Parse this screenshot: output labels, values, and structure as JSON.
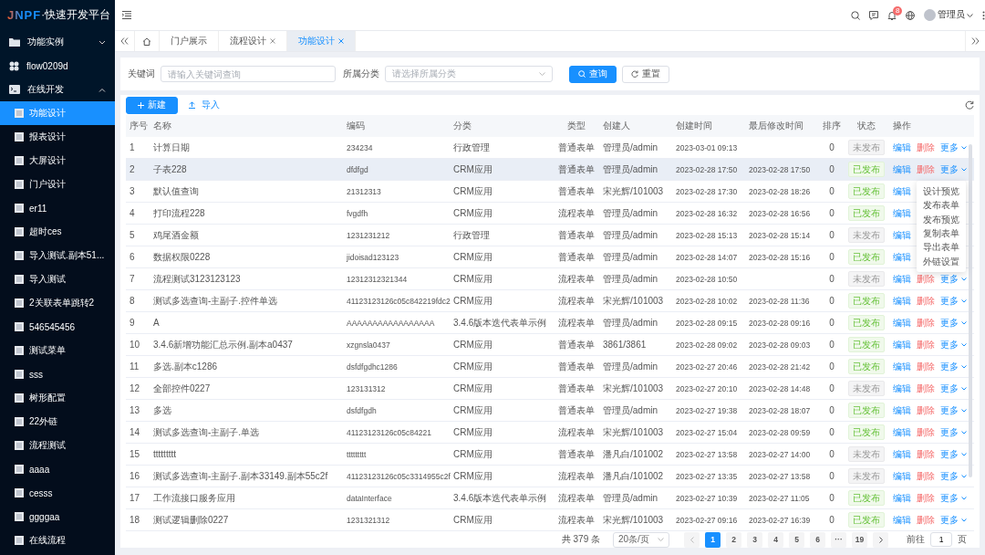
{
  "sidebar": {
    "logo": {
      "mark": "JNPF",
      "text": "·快速开发平台"
    },
    "items": [
      {
        "label": "功能实例",
        "expanded": false,
        "selected": false
      },
      {
        "label": "flow0209d",
        "selected": false
      },
      {
        "label": "在线开发",
        "expanded": true,
        "selected": false,
        "children": [
          {
            "label": "功能设计",
            "selected": true
          },
          {
            "label": "报表设计",
            "selected": false
          },
          {
            "label": "大屏设计",
            "selected": false
          },
          {
            "label": "门户设计",
            "selected": false
          },
          {
            "label": "er11",
            "selected": false
          },
          {
            "label": "超时ces",
            "selected": false
          },
          {
            "label": "导入测试.副本51...",
            "selected": false
          },
          {
            "label": "导入测试",
            "selected": false
          },
          {
            "label": "2关联表单跳转2",
            "selected": false
          },
          {
            "label": "546545456",
            "selected": false
          },
          {
            "label": "测试菜单",
            "selected": false
          },
          {
            "label": "sss",
            "selected": false
          },
          {
            "label": "树形配置",
            "selected": false
          },
          {
            "label": "22外链",
            "selected": false
          },
          {
            "label": "流程测试",
            "selected": false
          },
          {
            "label": "aaaa",
            "selected": false
          },
          {
            "label": "cesss",
            "selected": false
          },
          {
            "label": "ggggaa",
            "selected": false
          },
          {
            "label": "在线流程",
            "selected": false
          }
        ]
      }
    ]
  },
  "header": {
    "notification_count": "8",
    "user": "管理员"
  },
  "tabs": [
    {
      "label": "门户展示",
      "closable": false,
      "selected": false
    },
    {
      "label": "流程设计",
      "closable": true,
      "selected": false
    },
    {
      "label": "功能设计",
      "closable": true,
      "selected": true
    }
  ],
  "search": {
    "keyword_label": "关键词",
    "keyword_placeholder": "请输入关键词查询",
    "category_label": "所属分类",
    "category_placeholder": "请选择所属分类",
    "search_button": "查询",
    "reset_button": "重置"
  },
  "toolbar": {
    "new_button": "新建",
    "import_button": "导入"
  },
  "table": {
    "columns": [
      "序号",
      "名称",
      "编码",
      "分类",
      "类型",
      "创建人",
      "创建时间",
      "最后修改时间",
      "排序",
      "状态",
      "操作"
    ],
    "rows": [
      {
        "cells": [
          "1",
          "计算日期",
          "234234",
          "行政管理",
          "普通表单",
          "管理员/admin",
          "2023-03-01 09:13",
          "",
          "0"
        ],
        "status": "未发布",
        "published": false,
        "hovered": false,
        "actions": [
          {
            "kind": "edit",
            "label": "编辑"
          },
          {
            "kind": "delete",
            "label": "删除"
          },
          {
            "kind": "more",
            "label": "更多"
          }
        ]
      },
      {
        "cells": [
          "2",
          "子表228",
          "dfdfgd",
          "CRM应用",
          "普通表单",
          "管理员/admin",
          "2023-02-28 17:50",
          "2023-02-28 17:50",
          "0"
        ],
        "status": "已发布",
        "published": true,
        "hovered": true,
        "actions": [
          {
            "kind": "edit",
            "label": "编辑"
          },
          {
            "kind": "delete",
            "label": "删除"
          },
          {
            "kind": "more",
            "label": "更多"
          }
        ]
      },
      {
        "cells": [
          "3",
          "默认值查询",
          "21312313",
          "CRM应用",
          "普通表单",
          "宋光辉/101003",
          "2023-02-28 17:30",
          "2023-02-28 18:26",
          "0"
        ],
        "status": "已发布",
        "published": true,
        "hovered": false,
        "actions": [
          {
            "kind": "edit",
            "label": "编辑"
          }
        ]
      },
      {
        "cells": [
          "4",
          "打印流程228",
          "fvgdfh",
          "CRM应用",
          "流程表单",
          "管理员/admin",
          "2023-02-28 16:32",
          "2023-02-28 16:56",
          "0"
        ],
        "status": "已发布",
        "published": true,
        "hovered": false,
        "actions": [
          {
            "kind": "edit",
            "label": "编辑"
          }
        ]
      },
      {
        "cells": [
          "5",
          "鸡尾酒金额",
          "1231231212",
          "行政管理",
          "普通表单",
          "管理员/admin",
          "2023-02-28 15:13",
          "2023-02-28 15:14",
          "0"
        ],
        "status": "未发布",
        "published": false,
        "hovered": false,
        "actions": [
          {
            "kind": "edit",
            "label": "编辑"
          }
        ]
      },
      {
        "cells": [
          "6",
          "数据权限0228",
          "jidoisad123123",
          "CRM应用",
          "普通表单",
          "管理员/admin",
          "2023-02-28 14:07",
          "2023-02-28 15:16",
          "0"
        ],
        "status": "已发布",
        "published": true,
        "hovered": false,
        "actions": [
          {
            "kind": "edit",
            "label": "编辑"
          }
        ]
      },
      {
        "cells": [
          "7",
          "流程测试3123123123",
          "12312312321344",
          "CRM应用",
          "流程表单",
          "管理员/admin",
          "2023-02-28 10:50",
          "",
          "0"
        ],
        "status": "未发布",
        "published": false,
        "hovered": false,
        "actions": [
          {
            "kind": "edit",
            "label": "编辑"
          },
          {
            "kind": "delete",
            "label": "删除"
          },
          {
            "kind": "more",
            "label": "更多"
          }
        ]
      },
      {
        "cells": [
          "8",
          "测试多选查询-主副子.控件单选",
          "41123123126c05c842219fdc2",
          "CRM应用",
          "流程表单",
          "宋光辉/101003",
          "2023-02-28 10:02",
          "2023-02-28 11:36",
          "0"
        ],
        "status": "已发布",
        "published": true,
        "hovered": false,
        "actions": [
          {
            "kind": "edit",
            "label": "编辑"
          },
          {
            "kind": "delete",
            "label": "删除"
          },
          {
            "kind": "more",
            "label": "更多"
          }
        ]
      },
      {
        "cells": [
          "9",
          "A",
          "AAAAAAAAAAAAAAAAA",
          "3.4.6版本迭代表单示例",
          "流程表单",
          "管理员/admin",
          "2023-02-28 09:15",
          "2023-02-28 09:16",
          "0"
        ],
        "status": "已发布",
        "published": true,
        "hovered": false,
        "actions": [
          {
            "kind": "edit",
            "label": "编辑"
          },
          {
            "kind": "delete",
            "label": "删除"
          },
          {
            "kind": "more",
            "label": "更多"
          }
        ]
      },
      {
        "cells": [
          "10",
          "3.4.6新增功能汇总示例.副本a0437",
          "xzgnsla0437",
          "CRM应用",
          "普通表单",
          "3861/3861",
          "2023-02-28 09:02",
          "2023-02-28 09:03",
          "0"
        ],
        "status": "已发布",
        "published": true,
        "hovered": false,
        "actions": [
          {
            "kind": "edit",
            "label": "编辑"
          },
          {
            "kind": "delete",
            "label": "删除"
          },
          {
            "kind": "more",
            "label": "更多"
          }
        ]
      },
      {
        "cells": [
          "11",
          "多选.副本c1286",
          "dsfdfgdhc1286",
          "CRM应用",
          "普通表单",
          "管理员/admin",
          "2023-02-27 20:46",
          "2023-02-28 21:42",
          "0"
        ],
        "status": "已发布",
        "published": true,
        "hovered": false,
        "actions": [
          {
            "kind": "edit",
            "label": "编辑"
          },
          {
            "kind": "delete",
            "label": "删除"
          },
          {
            "kind": "more",
            "label": "更多"
          }
        ]
      },
      {
        "cells": [
          "12",
          "全部控件0227",
          "123131312",
          "CRM应用",
          "普通表单",
          "宋光辉/101003",
          "2023-02-27 20:10",
          "2023-02-28 14:48",
          "0"
        ],
        "status": "未发布",
        "published": false,
        "hovered": false,
        "actions": [
          {
            "kind": "edit",
            "label": "编辑"
          },
          {
            "kind": "delete",
            "label": "删除"
          },
          {
            "kind": "more",
            "label": "更多"
          }
        ]
      },
      {
        "cells": [
          "13",
          "多选",
          "dsfdfgdh",
          "CRM应用",
          "普通表单",
          "管理员/admin",
          "2023-02-27 19:38",
          "2023-02-28 18:07",
          "0"
        ],
        "status": "已发布",
        "published": true,
        "hovered": false,
        "actions": [
          {
            "kind": "edit",
            "label": "编辑"
          },
          {
            "kind": "delete",
            "label": "删除"
          },
          {
            "kind": "more",
            "label": "更多"
          }
        ]
      },
      {
        "cells": [
          "14",
          "测试多选查询-主副子.单选",
          "41123123126c05c84221",
          "CRM应用",
          "流程表单",
          "宋光辉/101003",
          "2023-02-27 15:04",
          "2023-02-28 09:59",
          "0"
        ],
        "status": "已发布",
        "published": true,
        "hovered": false,
        "actions": [
          {
            "kind": "edit",
            "label": "编辑"
          },
          {
            "kind": "delete",
            "label": "删除"
          },
          {
            "kind": "more",
            "label": "更多"
          }
        ]
      },
      {
        "cells": [
          "15",
          "ttttttttt",
          "ttttttttt",
          "CRM应用",
          "普通表单",
          "潘凡白/101002",
          "2023-02-27 13:58",
          "2023-02-27 14:00",
          "0"
        ],
        "status": "未发布",
        "published": false,
        "hovered": false,
        "actions": [
          {
            "kind": "edit",
            "label": "编辑"
          },
          {
            "kind": "delete",
            "label": "删除"
          },
          {
            "kind": "more",
            "label": "更多"
          }
        ]
      },
      {
        "cells": [
          "16",
          "测试多选查询-主副子.副本33149.副本55c2f",
          "41123123126c05c3314955c2f",
          "CRM应用",
          "流程表单",
          "潘凡白/101002",
          "2023-02-27 13:35",
          "2023-02-27 13:58",
          "0"
        ],
        "status": "未发布",
        "published": false,
        "hovered": false,
        "actions": [
          {
            "kind": "edit",
            "label": "编辑"
          },
          {
            "kind": "delete",
            "label": "删除"
          },
          {
            "kind": "more",
            "label": "更多"
          }
        ]
      },
      {
        "cells": [
          "17",
          "工作流接口服务应用",
          "dataInterface",
          "3.4.6版本迭代表单示例",
          "流程表单",
          "管理员/admin",
          "2023-02-27 10:39",
          "2023-02-27 11:05",
          "0"
        ],
        "status": "已发布",
        "published": true,
        "hovered": false,
        "actions": [
          {
            "kind": "edit",
            "label": "编辑"
          },
          {
            "kind": "delete",
            "label": "删除"
          },
          {
            "kind": "more",
            "label": "更多"
          }
        ]
      },
      {
        "cells": [
          "18",
          "测试逻辑删除0227",
          "1231321312",
          "CRM应用",
          "流程表单",
          "宋光辉/101003",
          "2023-02-27 09:16",
          "2023-02-27 16:39",
          "0"
        ],
        "status": "已发布",
        "published": true,
        "hovered": false,
        "actions": [
          {
            "kind": "edit",
            "label": "编辑"
          },
          {
            "kind": "delete",
            "label": "删除"
          },
          {
            "kind": "more",
            "label": "更多"
          }
        ]
      }
    ],
    "more_menu": [
      "设计预览",
      "发布表单",
      "发布预览",
      "复制表单",
      "导出表单",
      "外链设置"
    ]
  },
  "pagination": {
    "total": "共 379 条",
    "page_size": "20条/页",
    "pages": [
      {
        "label": "1",
        "selected": true
      },
      {
        "label": "2",
        "selected": false
      },
      {
        "label": "3",
        "selected": false
      },
      {
        "label": "4",
        "selected": false
      },
      {
        "label": "5",
        "selected": false
      },
      {
        "label": "6",
        "selected": false
      },
      {
        "label": "···",
        "selected": false
      },
      {
        "label": "19",
        "selected": false
      }
    ],
    "goto_label": "前往",
    "goto_value": "1",
    "page_unit": "页"
  }
}
